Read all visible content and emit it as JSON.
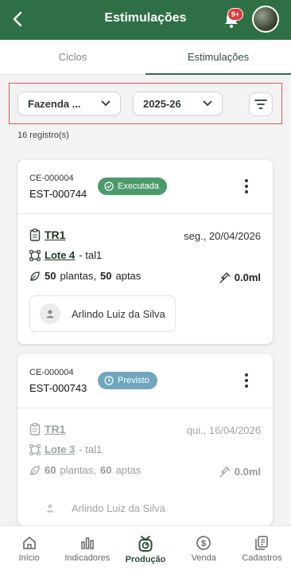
{
  "header": {
    "title": "Estimulações",
    "notification_badge": "9+"
  },
  "tabs": [
    {
      "label": "Ciclos",
      "active": false
    },
    {
      "label": "Estimulações",
      "active": true
    }
  ],
  "filters": {
    "farm": "Fazenda ...",
    "season": "2025-26"
  },
  "results_count": "16 registro(s)",
  "cards": [
    {
      "cycle_code": "CE-000004",
      "code": "EST-000744",
      "status": "Executada",
      "status_color": "#4c9a6a",
      "tree": "TR1",
      "date": "seg., 20/04/2026",
      "lot": "Lote 4",
      "lot_suffix": "- tal1",
      "plants": "50",
      "plants_label": "plantas,",
      "apt": "50",
      "apt_label": "aptas",
      "volume": "0.0ml",
      "operator": "Arlindo Luiz da Silva"
    },
    {
      "cycle_code": "CE-000004",
      "code": "EST-000743",
      "status": "Previsto",
      "status_color": "#6ea7bd",
      "tree": "TR1",
      "date": "qui., 16/04/2026",
      "lot": "Lote 3",
      "lot_suffix": "- tal1",
      "plants": "60",
      "plants_label": "plantas,",
      "apt": "60",
      "apt_label": "aptas",
      "volume": "0.0ml",
      "operator": "Arlindo Luiz da Silva"
    }
  ],
  "bottom_nav": [
    {
      "label": "Início",
      "icon": "home-icon",
      "active": false
    },
    {
      "label": "Indicadores",
      "icon": "bar-chart-icon",
      "active": false
    },
    {
      "label": "Produção",
      "icon": "production-icon",
      "active": true
    },
    {
      "label": "Venda",
      "icon": "dollar-icon",
      "active": false
    },
    {
      "label": "Cadastros",
      "icon": "documents-icon",
      "active": false
    }
  ],
  "colors": {
    "brand": "#2f6f45",
    "highlight_border": "#e25555"
  }
}
